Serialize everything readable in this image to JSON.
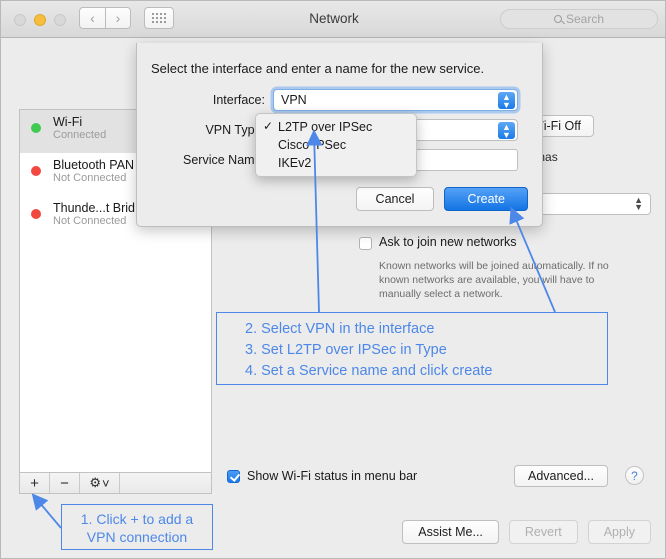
{
  "window": {
    "title": "Network",
    "traffic_lights": [
      "close-red-inactive",
      "minimize-yellow",
      "maximize-inactive"
    ],
    "nav_back_icon": "‹",
    "nav_forward_icon": "›",
    "grid_icon": "grid-icon"
  },
  "search": {
    "placeholder": "Search",
    "icon": "search-icon"
  },
  "sidebar": {
    "items": [
      {
        "name": "Wi-Fi",
        "status": "Connected",
        "dot": "green",
        "selected": true
      },
      {
        "name": "Bluetooth PAN",
        "status": "Not Connected",
        "dot": "red",
        "selected": false
      },
      {
        "name": "Thunde...t Brid",
        "status": "Not Connected",
        "dot": "red",
        "selected": false
      }
    ],
    "toolbar": {
      "add_label": "+",
      "remove_label": "−",
      "gear_label": "⚙",
      "gear_chevron": "˅"
    }
  },
  "right_panel": {
    "wifi_off_button": "Wi-Fi Off",
    "status_text": "ay and has",
    "network_name_stepper": "⌃⌄",
    "ask_to_join": {
      "label": "Ask to join new networks",
      "checked": false,
      "description": "Known networks will be joined automatically. If no known networks are available, you will have to manually select a network."
    },
    "show_status": {
      "label": "Show Wi-Fi status in menu bar",
      "checked": true
    },
    "advanced_button": "Advanced...",
    "help_button": "?"
  },
  "footer": {
    "assist_button": "Assist Me...",
    "revert_button": "Revert",
    "apply_button": "Apply",
    "revert_enabled": false,
    "apply_enabled": false
  },
  "dialog": {
    "headline": "Select the interface and enter a name for the new service.",
    "interface_label": "Interface:",
    "interface_value": "VPN",
    "vpn_type_label": "VPN Type:",
    "service_name_label": "Service Name:",
    "service_name_value": "",
    "stepper_glyph": "⌃⌄",
    "cancel_button": "Cancel",
    "create_button": "Create"
  },
  "vpn_type_menu": {
    "checkmark": "✓",
    "items": [
      {
        "label": "L2TP over IPSec",
        "checked": true
      },
      {
        "label": "Cisco IPSec",
        "checked": false
      },
      {
        "label": "IKEv2",
        "checked": false
      }
    ]
  },
  "annotations": {
    "accent_color": "#4d88e8",
    "steps": [
      "2. Select VPN in the interface",
      "3. Set L2TP over IPSec in Type",
      "4. Set a Service name and click create"
    ],
    "click_plus": [
      "1. Click + to add a",
      "VPN connection"
    ]
  }
}
